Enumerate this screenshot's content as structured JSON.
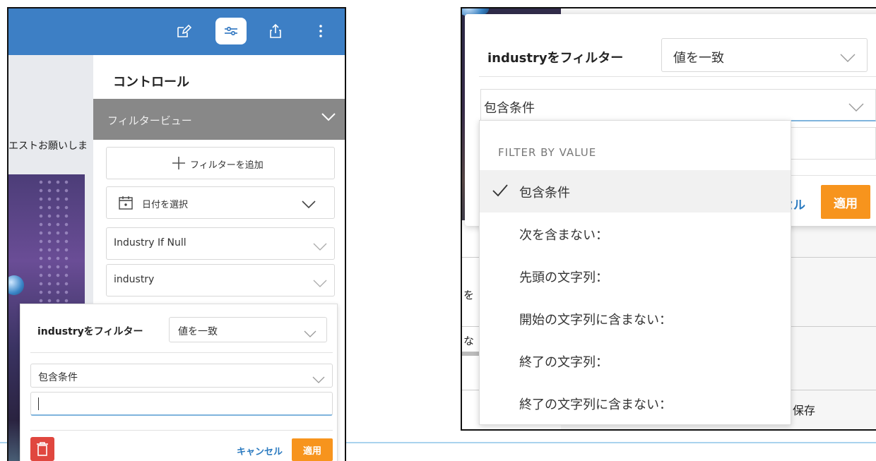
{
  "left": {
    "topbar_icons": [
      "sparkle-edit-icon",
      "sliders-icon",
      "share-icon",
      "more-vert-icon"
    ],
    "side_text": "エストお願いしま",
    "controls_title": "コントロール",
    "filter_view_label": "フィルタービュー",
    "add_filter_label": "フィルターを追加",
    "date_select_label": "日付を選択",
    "dropdown1_label": "Industry If Null",
    "dropdown2_label": "industry",
    "popup": {
      "title": "industryをフィルター",
      "match_select": "値を一致",
      "condition_select": "包含条件",
      "input_value": "",
      "cancel_label": "キャンセル",
      "apply_label": "適用"
    }
  },
  "right": {
    "popup_title": "industryをフィルター",
    "match_select": "値を一致",
    "condition_select": "包含条件",
    "bg_cancel_fragment": "セル",
    "apply_label": "適用",
    "bg_fragment_1": "を",
    "bg_fragment_2": "な",
    "bg_save": "保存",
    "dropdown": {
      "header": "FILTER BY VALUE",
      "items": [
        {
          "label": "包含条件",
          "selected": true
        },
        {
          "label": "次を含まない：",
          "selected": false
        },
        {
          "label": "先頭の文字列：",
          "selected": false
        },
        {
          "label": "開始の文字列に含まない：",
          "selected": false
        },
        {
          "label": "終了の文字列：",
          "selected": false
        },
        {
          "label": "終了の文字列に含まない：",
          "selected": false
        }
      ]
    }
  },
  "colors": {
    "topbar_blue": "#3d7fc5",
    "filter_view_gray": "#888888",
    "apply_orange": "#f7941d",
    "delete_red": "#e0473f",
    "cancel_link": "#2a7ac0"
  }
}
